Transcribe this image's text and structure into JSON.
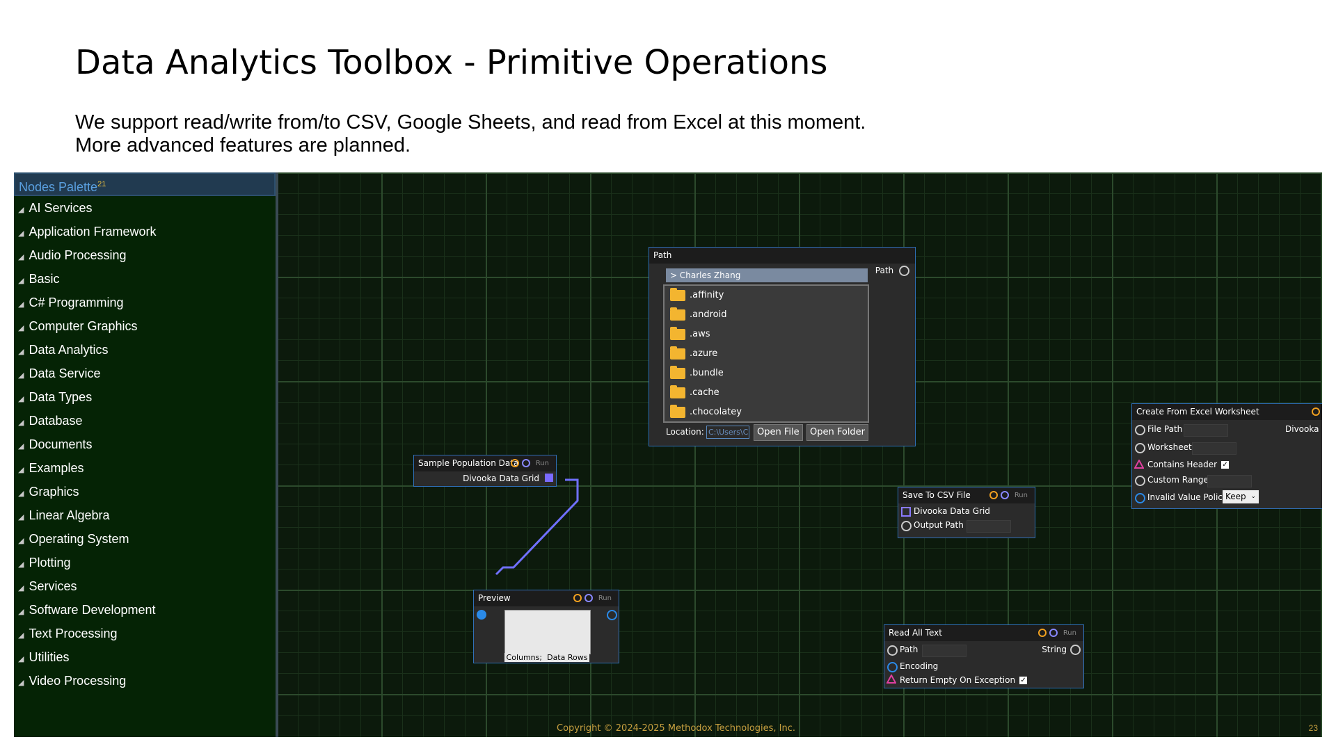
{
  "slide": {
    "title": "Data Analytics Toolbox - Primitive Operations",
    "subtitle_line1": "We support read/write from/to CSV, Google Sheets, and read from Excel at this moment.",
    "subtitle_line2": "More advanced features are planned."
  },
  "palette": {
    "title": "Nodes Palette",
    "count": "21",
    "items": [
      "AI Services",
      "Application Framework",
      "Audio Processing",
      "Basic",
      "C# Programming",
      "Computer Graphics",
      "Data Analytics",
      "Data Service",
      "Data Types",
      "Database",
      "Documents",
      "Examples",
      "Graphics",
      "Linear Algebra",
      "Operating System",
      "Plotting",
      "Services",
      "Software Development",
      "Text Processing",
      "Utilities",
      "Video Processing"
    ]
  },
  "nodes": {
    "path": {
      "title": "Path",
      "breadcrumb": "> Charles Zhang",
      "files": [
        ".affinity",
        ".android",
        ".aws",
        ".azure",
        ".bundle",
        ".cache",
        ".chocolatey"
      ],
      "location_label": "Location:",
      "location_value": "C:\\Users\\C",
      "open_file": "Open File",
      "open_folder": "Open Folder",
      "out_label": "Path"
    },
    "sample": {
      "title": "Sample Population Data",
      "run": "Run",
      "output": "Divooka Data Grid"
    },
    "preview": {
      "title": "Preview",
      "run": "Run",
      "columns": "Columns;",
      "rows": "Data Rows"
    },
    "save_csv": {
      "title": "Save To CSV File",
      "run": "Run",
      "in1": "Divooka Data Grid",
      "in2": "Output Path"
    },
    "read_text": {
      "title": "Read All Text",
      "run": "Run",
      "in1": "Path",
      "in2": "Encoding",
      "in3": "Return Empty On Exception",
      "out": "String"
    },
    "excel": {
      "title": "Create From Excel Worksheet",
      "in1": "File Path",
      "in2": "Worksheet",
      "in3": "Contains Header",
      "in4": "Custom Range",
      "in5": "Invalid Value Policy",
      "policy": "Keep",
      "out": "Divooka Data"
    }
  },
  "footer": {
    "copyright": "Copyright © 2024-2025 Methodox Technologies, Inc.",
    "page": "23"
  },
  "colors": {
    "canvas": "#0c1a0c",
    "palette_bg": "#052305",
    "node_border": "#2f6fb8",
    "accent_orange": "#f0a020",
    "accent_purple": "#8888ff"
  }
}
